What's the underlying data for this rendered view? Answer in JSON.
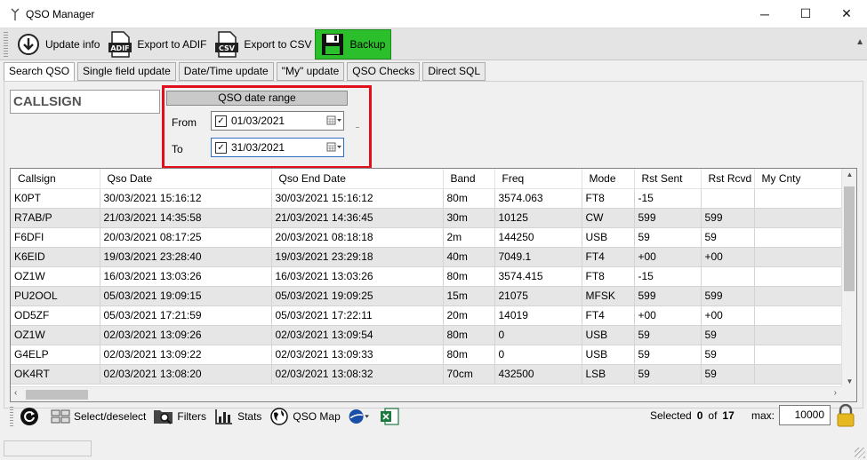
{
  "window": {
    "title": "QSO Manager",
    "minimize": "─",
    "maximize": "☐",
    "close": "✕"
  },
  "toolbar": {
    "update_info": "Update info",
    "export_adif": "Export to ADIF",
    "export_csv": "Export to CSV",
    "backup": "Backup",
    "adif_badge": "ADIF",
    "csv_badge": "CSV"
  },
  "tabs": [
    "Search QSO",
    "Single field update",
    "Date/Time update",
    "\"My\" update",
    "QSO Checks",
    "Direct SQL"
  ],
  "search": {
    "callsign_placeholder": "CALLSIGN",
    "range_title": "QSO date range",
    "from_label": "From",
    "to_label": "To",
    "from_date": "01/03/2021",
    "to_date": "31/03/2021"
  },
  "table": {
    "columns": [
      "Callsign",
      "Qso Date",
      "Qso End Date",
      "Band",
      "Freq",
      "Mode",
      "Rst Sent",
      "Rst Rcvd",
      "My Cnty"
    ],
    "rows": [
      [
        "K0PT",
        "30/03/2021 15:16:12",
        "30/03/2021 15:16:12",
        "80m",
        "3574.063",
        "FT8",
        "-15",
        "",
        ""
      ],
      [
        "R7AB/P",
        "21/03/2021 14:35:58",
        "21/03/2021 14:36:45",
        "30m",
        "10125",
        "CW",
        "599",
        "599",
        ""
      ],
      [
        "F6DFI",
        "20/03/2021 08:17:25",
        "20/03/2021 08:18:18",
        "2m",
        "144250",
        "USB",
        "59",
        "59",
        ""
      ],
      [
        "K6EID",
        "19/03/2021 23:28:40",
        "19/03/2021 23:29:18",
        "40m",
        "7049.1",
        "FT4",
        "+00",
        "+00",
        ""
      ],
      [
        "OZ1W",
        "16/03/2021 13:03:26",
        "16/03/2021 13:03:26",
        "80m",
        "3574.415",
        "FT8",
        "-15",
        "",
        ""
      ],
      [
        "PU2OOL",
        "05/03/2021 19:09:15",
        "05/03/2021 19:09:25",
        "15m",
        "21075",
        "MFSK",
        "599",
        "599",
        ""
      ],
      [
        "OD5ZF",
        "05/03/2021 17:21:59",
        "05/03/2021 17:22:11",
        "20m",
        "14019",
        "FT4",
        "+00",
        "+00",
        ""
      ],
      [
        "OZ1W",
        "02/03/2021 13:09:26",
        "02/03/2021 13:09:54",
        "80m",
        "0",
        "USB",
        "59",
        "59",
        ""
      ],
      [
        "G4ELP",
        "02/03/2021 13:09:22",
        "02/03/2021 13:09:33",
        "80m",
        "0",
        "USB",
        "59",
        "59",
        ""
      ],
      [
        "OK4RT",
        "02/03/2021 13:08:20",
        "02/03/2021 13:08:32",
        "70cm",
        "432500",
        "LSB",
        "59",
        "59",
        ""
      ]
    ]
  },
  "bottombar": {
    "select_deselect": "Select/deselect",
    "filters": "Filters",
    "stats": "Stats",
    "qso_map": "QSO Map",
    "selected_label": "Selected",
    "selected_count": "0",
    "of_label": "of",
    "total_count": "17",
    "max_label": "max:",
    "max_value": "10000"
  },
  "colors": {
    "backup_bg": "#2bbf2b",
    "highlight": "#e2101c",
    "excel_green": "#1d7a3f"
  }
}
